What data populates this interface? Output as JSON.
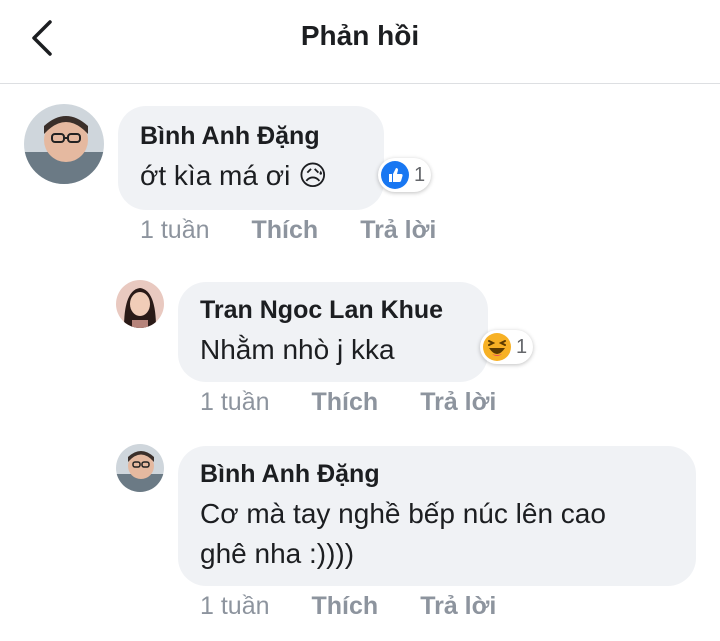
{
  "header": {
    "title": "Phản hồi"
  },
  "comments": [
    {
      "author": "Bình Anh Đặng",
      "text": "ớt kìa má ơi 😥",
      "reaction_count": "1",
      "reaction_icon": "like-icon",
      "time": "1 tuần",
      "like_label": "Thích",
      "reply_label": "Trả lời"
    },
    {
      "author": "Tran Ngoc Lan Khue",
      "text": "Nhằm nhò j kka",
      "reaction_count": "1",
      "reaction_icon": "haha-icon",
      "time": "1 tuần",
      "like_label": "Thích",
      "reply_label": "Trả lời"
    },
    {
      "author": "Bình Anh Đặng",
      "text_line1": "Cơ mà tay nghề bếp núc lên cao",
      "text_line2": "ghê nha :))))",
      "time": "1 tuần",
      "like_label": "Thích",
      "reply_label": "Trả lời"
    }
  ],
  "colors": {
    "bubble": "#f0f2f5",
    "meta_text": "#8d949e",
    "like_blue": "#1877f2",
    "haha_yellow": "#f7b125"
  }
}
